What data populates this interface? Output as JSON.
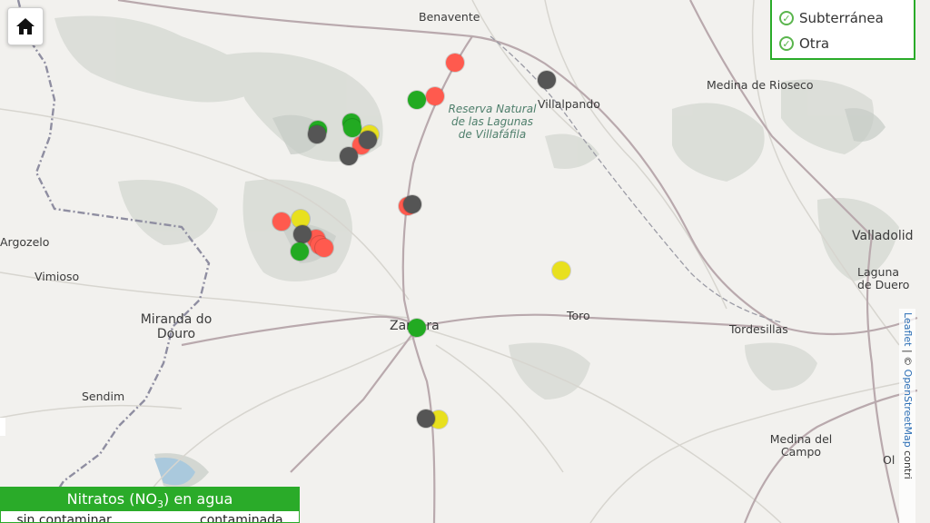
{
  "map": {
    "places": [
      {
        "name": "Benavente"
      },
      {
        "name": "Villalpando"
      },
      {
        "name": "Medina de Rioseco"
      },
      {
        "name": "Valladolid"
      },
      {
        "name": "Laguna de Duero"
      },
      {
        "name": "Argozelo"
      },
      {
        "name": "Vimioso"
      },
      {
        "name": "Miranda do Douro"
      },
      {
        "name": "Zamora"
      },
      {
        "name": "Toro"
      },
      {
        "name": "Tordesillas"
      },
      {
        "name": "Sendim"
      },
      {
        "name": "Medina del Campo"
      },
      {
        "name": "Ol"
      }
    ],
    "reserve_label": "Reserva Natural de las Lagunas de Villafáfila"
  },
  "legend": {
    "items": [
      {
        "label": "Subterránea",
        "checked": true
      },
      {
        "label": "Otra",
        "checked": true
      }
    ]
  },
  "attribution": {
    "leaflet": "Leaflet",
    "sep": " | © ",
    "osm": "OpenStreetMap",
    "rest": " contri"
  },
  "nitrate_panel": {
    "title_prefix": "Nitratos (NO",
    "title_sub": "3",
    "title_suffix": ") en agua",
    "col1": "...sin contaminar...",
    "col2": "...contaminada..."
  },
  "markers": [
    {
      "color": "#ff5a4e"
    },
    {
      "color": "#22aa22"
    },
    {
      "color": "#ff5a4e"
    },
    {
      "color": "#555555"
    },
    {
      "color": "#22aa22"
    },
    {
      "color": "#555555"
    },
    {
      "color": "#22aa22"
    },
    {
      "color": "#22aa22"
    },
    {
      "color": "#e8e01e"
    },
    {
      "color": "#ff5a4e"
    },
    {
      "color": "#555555"
    },
    {
      "color": "#555555"
    },
    {
      "color": "#ff5a4e"
    },
    {
      "color": "#555555"
    },
    {
      "color": "#ff5a4e"
    },
    {
      "color": "#e8e01e"
    },
    {
      "color": "#ff5a4e"
    },
    {
      "color": "#555555"
    },
    {
      "color": "#22aa22"
    },
    {
      "color": "#ff5a4e"
    },
    {
      "color": "#ff5a4e"
    },
    {
      "color": "#e8e01e"
    },
    {
      "color": "#22aa22"
    },
    {
      "color": "#e8e01e"
    },
    {
      "color": "#555555"
    }
  ],
  "colors": {
    "green": "#2aab29",
    "red": "#ff5a4e",
    "grey": "#555555",
    "yellow": "#e8e01e"
  }
}
